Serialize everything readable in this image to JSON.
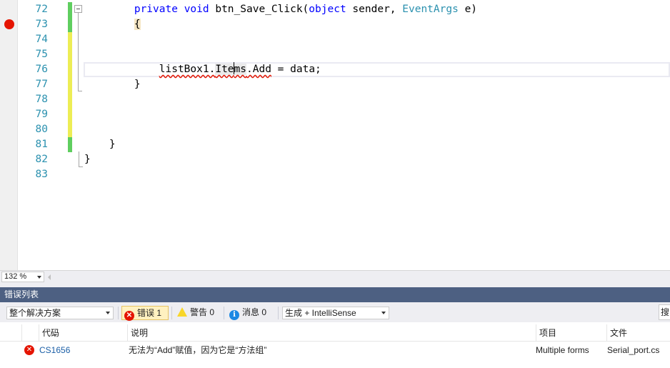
{
  "editor": {
    "breakpoint_lines": [
      "73"
    ],
    "lines": [
      {
        "num": "72",
        "change": "green",
        "segments": [
          {
            "t": "        ",
            "c": ""
          },
          {
            "t": "private",
            "c": "kw"
          },
          {
            "t": " ",
            "c": ""
          },
          {
            "t": "void",
            "c": "kw"
          },
          {
            "t": " btn_Save_Click(",
            "c": ""
          },
          {
            "t": "object",
            "c": "kw"
          },
          {
            "t": " sender, ",
            "c": ""
          },
          {
            "t": "EventArgs",
            "c": "ty"
          },
          {
            "t": " e)",
            "c": ""
          }
        ]
      },
      {
        "num": "73",
        "change": "green",
        "segments": [
          {
            "t": "        ",
            "c": ""
          },
          {
            "t": "{",
            "c": "brace-hl"
          }
        ]
      },
      {
        "num": "74",
        "change": "yellow",
        "segments": []
      },
      {
        "num": "75",
        "change": "yellow",
        "segments": []
      },
      {
        "num": "76",
        "change": "yellow",
        "segments": [
          {
            "t": "            ",
            "c": ""
          },
          {
            "t": "listBox1.",
            "c": "squig"
          },
          {
            "t": "Items",
            "c": "squig items-hl"
          },
          {
            "t": ".Add",
            "c": "squig"
          },
          {
            "t": " = data;",
            "c": ""
          }
        ]
      },
      {
        "num": "77",
        "change": "yellow",
        "segments": [
          {
            "t": "        }",
            "c": ""
          }
        ]
      },
      {
        "num": "78",
        "change": "yellow",
        "segments": []
      },
      {
        "num": "79",
        "change": "yellow",
        "segments": []
      },
      {
        "num": "80",
        "change": "yellow",
        "segments": []
      },
      {
        "num": "81",
        "change": "green",
        "segments": [
          {
            "t": "    }",
            "c": ""
          }
        ]
      },
      {
        "num": "82",
        "change": "",
        "segments": [
          {
            "t": "}",
            "c": ""
          }
        ]
      },
      {
        "num": "83",
        "change": "",
        "segments": []
      }
    ],
    "zoom": "132 %"
  },
  "error_list": {
    "title": "错误列表",
    "scope": "整个解决方案",
    "errors_label": "错误 1",
    "warnings_label": "警告 0",
    "messages_label": "消息 0",
    "source_filter": "生成 + IntelliSense",
    "search_placeholder": "搜",
    "columns": {
      "code": "代码",
      "description": "说明",
      "project": "项目",
      "file": "文件"
    },
    "rows": [
      {
        "code": "CS1656",
        "description": "无法为“Add”赋值，因为它是“方法组”",
        "project": "Multiple forms",
        "file": "Serial_port.cs"
      }
    ]
  },
  "colors": {
    "breakpoint": "#e51400",
    "keyword": "#0000ff",
    "type": "#2b91af",
    "panel_title": "#4d6082"
  }
}
